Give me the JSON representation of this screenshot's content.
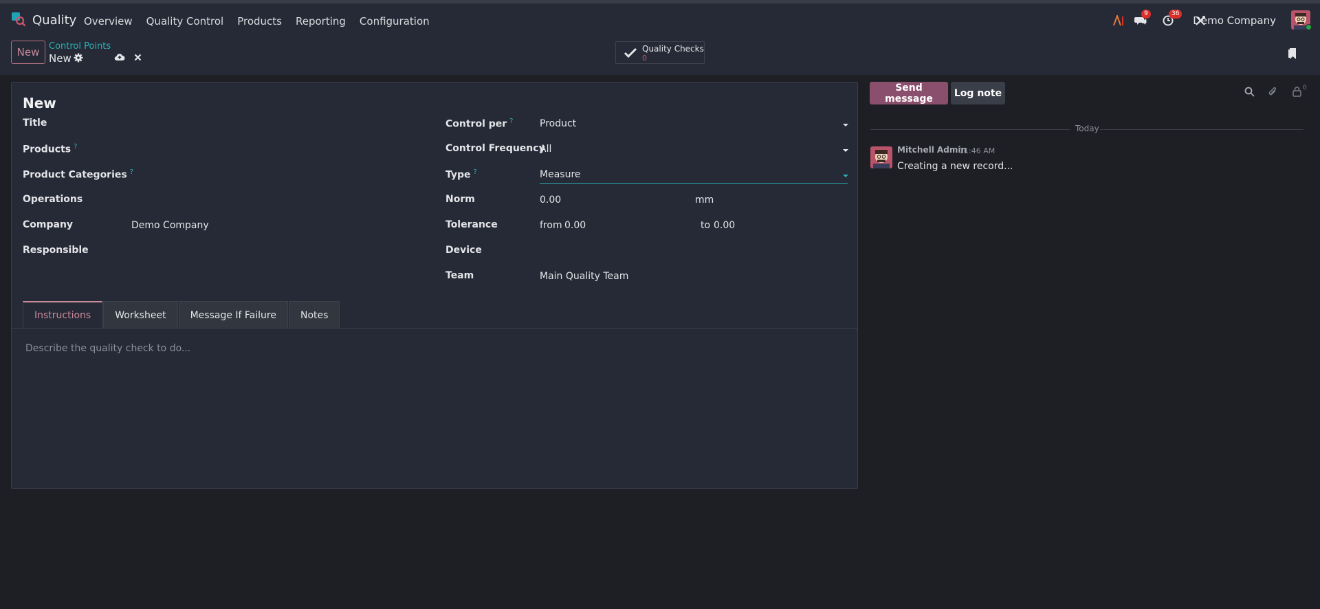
{
  "navbar": {
    "app_name": "Quality",
    "menu": [
      "Overview",
      "Quality Control",
      "Products",
      "Reporting",
      "Configuration"
    ],
    "messages_badge": "9",
    "activities_badge": "36",
    "company": "Demo Company"
  },
  "control_panel": {
    "new_label": "New",
    "breadcrumb_parent": "Control Points",
    "breadcrumb_current": "New",
    "smart_button_label": "Quality Checks",
    "smart_button_count": "0"
  },
  "form": {
    "record_title": "New",
    "left_labels": {
      "title": "Title",
      "products": "Products",
      "product_categories": "Product Categories",
      "operations": "Operations",
      "company": "Company",
      "responsible": "Responsible"
    },
    "company_value": "Demo Company",
    "right_labels": {
      "control_per": "Control per",
      "control_frequency": "Control Frequency",
      "type": "Type",
      "norm": "Norm",
      "tolerance": "Tolerance",
      "device": "Device",
      "team": "Team"
    },
    "control_per_value": "Product",
    "control_frequency_value": "All",
    "type_value": "Measure",
    "norm_value": "0.00",
    "norm_unit": "mm",
    "tolerance_from_label": "from",
    "tolerance_from_value": "0.00",
    "tolerance_to_label": "to",
    "tolerance_to_value": "0.00",
    "team_value": "Main Quality Team",
    "help_mark": "?",
    "tabs": [
      "Instructions",
      "Worksheet",
      "Message If Failure",
      "Notes"
    ],
    "instructions_placeholder": "Describe the quality check to do..."
  },
  "chatter": {
    "send_message": "Send message",
    "log_note": "Log note",
    "followers_count": "0",
    "date_separator": "Today",
    "author": "Mitchell Admin",
    "time": "11:46 AM",
    "body": "Creating a new record..."
  },
  "colors": {
    "accent": "#c98a9a",
    "link": "#2ab0b5",
    "primary_button": "#8b4f6e",
    "background": "#1e1f25",
    "sheet": "#262a36"
  }
}
